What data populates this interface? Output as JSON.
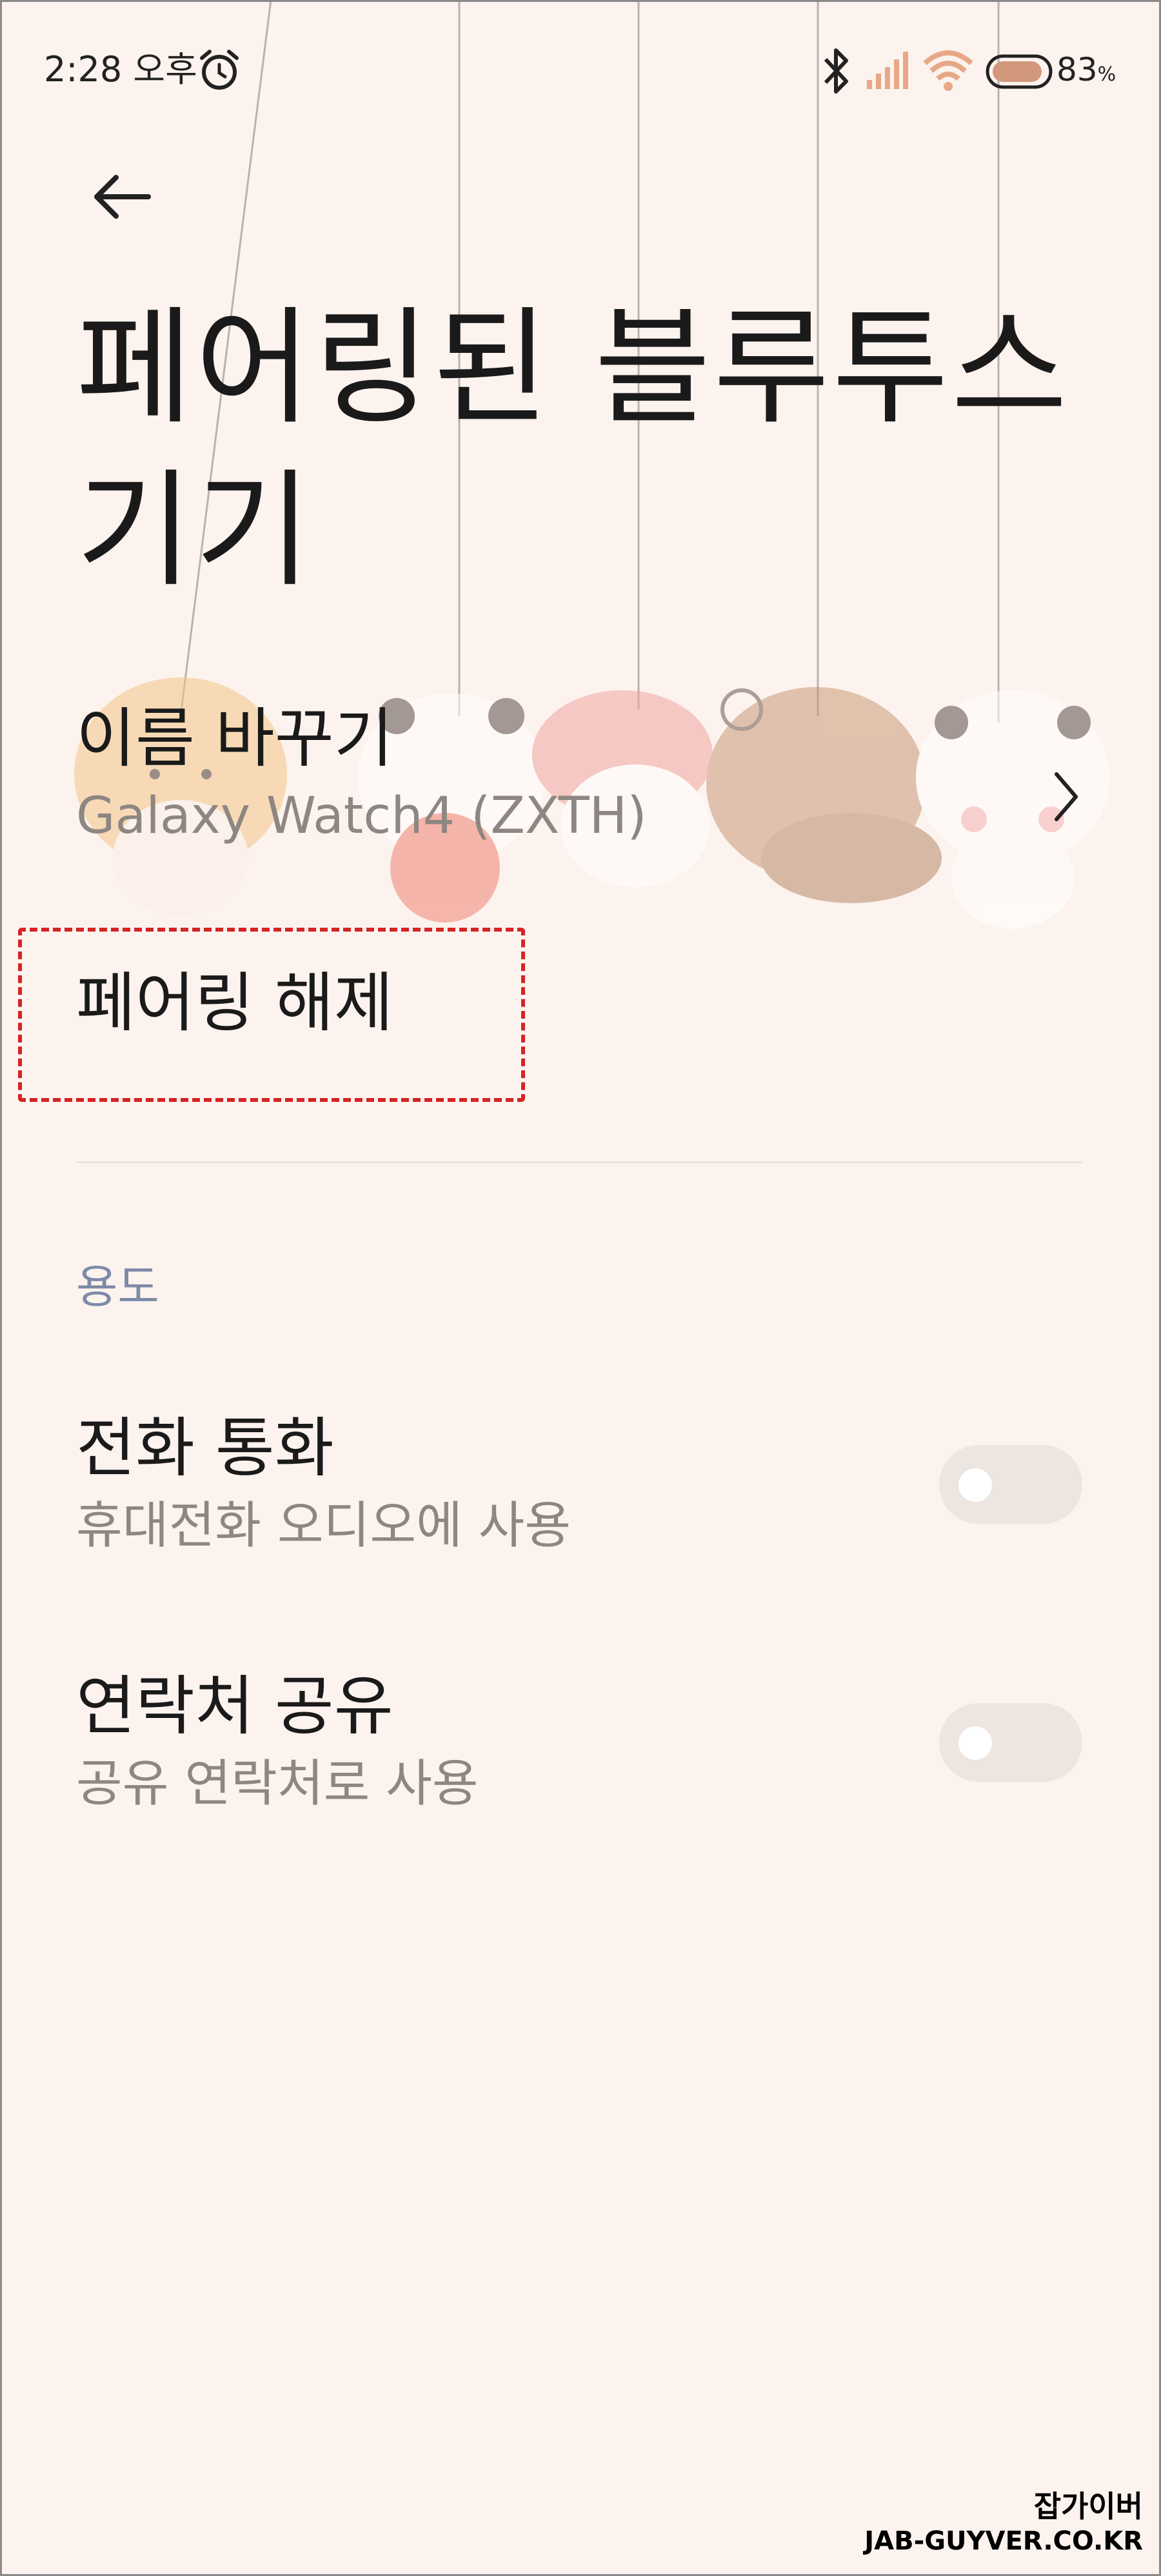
{
  "status_bar": {
    "time": "2:28 오후",
    "battery_level": "83",
    "battery_unit": "%"
  },
  "header": {
    "back_icon": "back-arrow-icon",
    "title": "페어링된 블루투스 기기"
  },
  "device": {
    "rename_label": "이름 바꾸기",
    "name": "Galaxy Watch4 (ZXTH)",
    "unpair_label": "페어링 해제"
  },
  "usage": {
    "section_label": "용도",
    "calls": {
      "title": "전화 통화",
      "description": "휴대전화 오디오에 사용",
      "enabled": false
    },
    "contacts": {
      "title": "연락처 공유",
      "description": "공유 연락처로 사용",
      "enabled": false
    }
  },
  "watermark": {
    "korean": "잡가이버",
    "domain": "JAB-GUYVER.CO.KR"
  },
  "colors": {
    "background": "#fdf3ee",
    "highlight": "#d42424",
    "section_header": "#7d8aa8",
    "secondary_text": "#8d8682",
    "toggle_off": "#ede5e0"
  }
}
